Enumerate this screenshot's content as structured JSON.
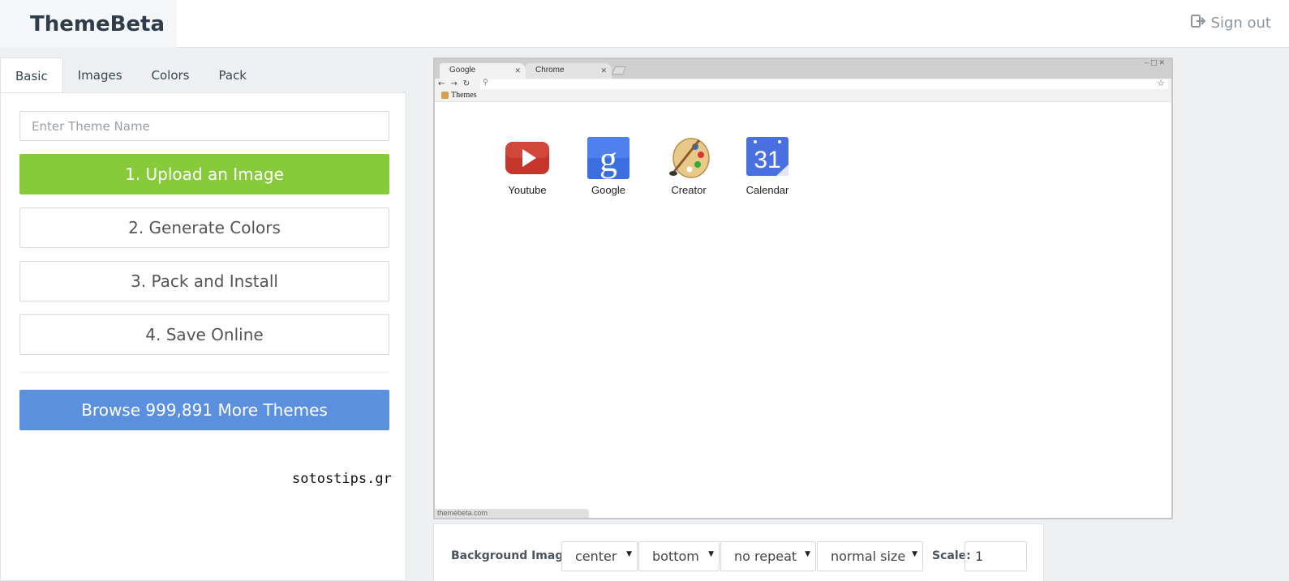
{
  "header": {
    "brand": "ThemeBeta",
    "signout_label": "Sign out"
  },
  "tabs": [
    {
      "label": "Basic",
      "active": true
    },
    {
      "label": "Images",
      "active": false
    },
    {
      "label": "Colors",
      "active": false
    },
    {
      "label": "Pack",
      "active": false
    }
  ],
  "basic": {
    "theme_name_placeholder": "Enter Theme Name",
    "theme_name_value": "",
    "step1": "1. Upload an Image",
    "step2": "2. Generate Colors",
    "step3": "3. Pack and Install",
    "step4": "4. Save Online",
    "browse": "Browse 999,891 More Themes",
    "watermark": "sotostips.gr"
  },
  "preview": {
    "tabs": [
      "Google",
      "Chrome"
    ],
    "bookmark": "Themes",
    "apps": [
      {
        "label": "Youtube",
        "icon": "youtube-icon"
      },
      {
        "label": "Google",
        "icon": "google-icon"
      },
      {
        "label": "Creator",
        "icon": "palette-icon"
      },
      {
        "label": "Calendar",
        "icon": "calendar-icon"
      }
    ],
    "calendar_day": "31",
    "status_text": "themebeta.com"
  },
  "background_controls": {
    "label": "Background Image:",
    "position_x": "center",
    "position_y": "bottom",
    "repeat": "no repeat",
    "size": "normal size",
    "scale_label": "Scale:",
    "scale_value": "1"
  },
  "colors": {
    "green": "#87cb3a",
    "blue": "#5b90de",
    "brand_text": "#2f3d4a"
  }
}
